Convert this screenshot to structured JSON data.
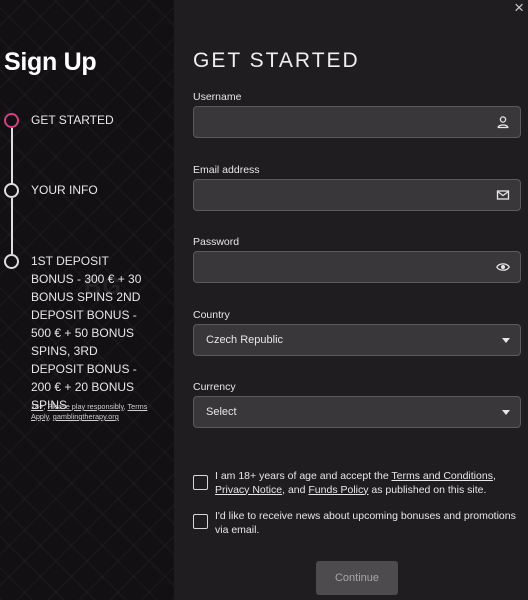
{
  "close_label": "×",
  "sidebar": {
    "title": "Sign Up",
    "steps": [
      {
        "label": "GET STARTED"
      },
      {
        "label": "YOUR INFO"
      },
      {
        "label": "1ST DEPOSIT BONUS - 300 € + 30 BONUS SPINS 2ND DEPOSIT BONUS - 500 € + 50 BONUS SPINS, 3RD DEPOSIT BONUS - 200 € + 20 BONUS SPINS"
      }
    ],
    "legal": {
      "age": "18+",
      "responsible": "Please play responsibly",
      "terms": "Terms Apply",
      "therapy": "gamblingtherapy.org"
    }
  },
  "form": {
    "title": "GET STARTED",
    "username": {
      "label": "Username",
      "value": ""
    },
    "email": {
      "label": "Email address",
      "value": ""
    },
    "password": {
      "label": "Password",
      "value": ""
    },
    "country": {
      "label": "Country",
      "value": "Czech Republic"
    },
    "currency": {
      "label": "Currency",
      "value": "Select"
    },
    "consent": {
      "prefix": "I am 18+ years of age and accept the ",
      "terms_link": "Terms and Conditions",
      "comma": ",",
      "privacy_link": "Privacy Notice",
      "and": ", and ",
      "funds_link": "Funds Policy",
      "suffix": " as published on this site."
    },
    "newsletter": "I'd like to receive news about upcoming bonuses and promotions via email.",
    "continue_label": "Continue"
  },
  "colors": {
    "accent": "#d63d82",
    "panel_bg": "#121012",
    "page_bg": "#201d20",
    "field_bg": "#3a373a"
  },
  "icons": {
    "username": "user-icon",
    "email": "envelope-icon",
    "password": "eye-icon",
    "close": "close-icon",
    "dropdown": "chevron-down-icon"
  }
}
